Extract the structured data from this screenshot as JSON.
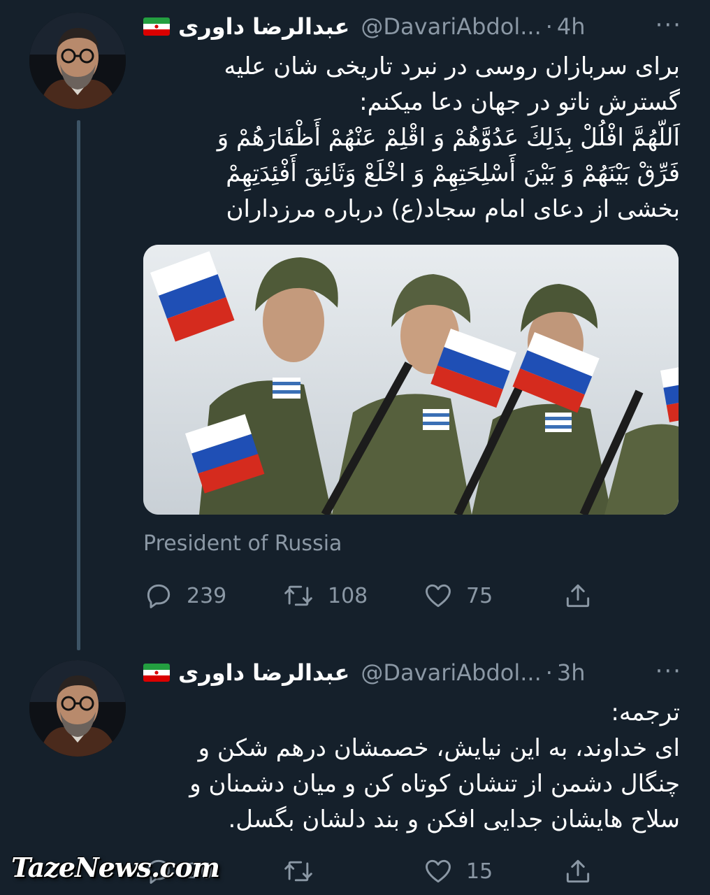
{
  "tweets": [
    {
      "author_name": "عبدالرضا داوری",
      "handle": "@DavariAbdol...",
      "time": "4h",
      "more": "···",
      "text_lines": [
        "برای سربازان روسی در نبرد تاریخی شان علیه",
        "گسترش ناتو در جهان دعا میکنم:",
        "اَللّهُمَّ افْلُلْ بِذَلِكَ عَدُوَّهُمْ وَ اقْلِمْ عَنْهُمْ أَظْفَارَهُمْ وَ",
        "فَرِّقْ بَيْنَهُمْ وَ بَيْنَ أَسْلِحَتِهِمْ وَ اخْلَعْ وَثَائِقَ أَفْئِدَتِهِمْ",
        "بخشی از دعای امام سجاد(ع) درباره مرزداران"
      ],
      "media_caption": "President of Russia",
      "replies": "239",
      "retweets": "108",
      "likes": "75"
    },
    {
      "author_name": "عبدالرضا داوری",
      "handle": "@DavariAbdol...",
      "time": "3h",
      "more": "···",
      "text_lines": [
        "ترجمه:",
        "ای خداوند، به این نیایش، خصمشان درهم شکن و",
        "چنگال دشمن از تنشان کوتاه کن و میان دشمنان و",
        "سلاح هایشان جدایی افکن و بند دلشان بگسل."
      ],
      "replies": "20",
      "retweets": "",
      "likes": "15"
    }
  ],
  "watermark": "TazeNews.com",
  "colors": {
    "background": "#15202b",
    "secondary_text": "#8b98a5",
    "thread_line": "#3d5466"
  }
}
